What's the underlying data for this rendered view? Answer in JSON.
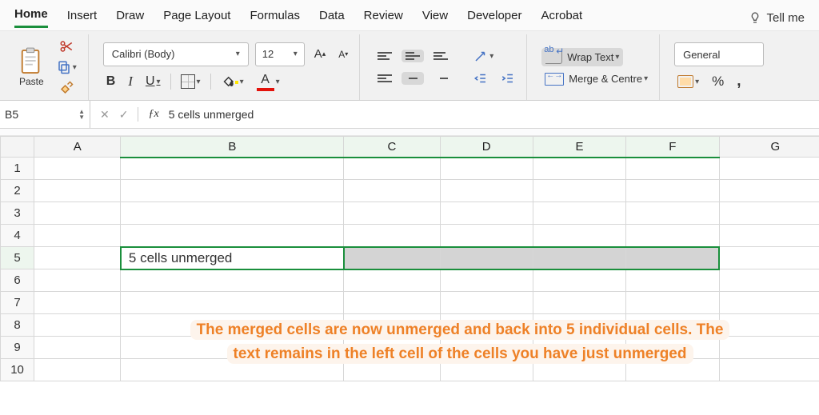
{
  "tabs": [
    "Home",
    "Insert",
    "Draw",
    "Page Layout",
    "Formulas",
    "Data",
    "Review",
    "View",
    "Developer",
    "Acrobat"
  ],
  "active_tab_index": 0,
  "tellme_label": "Tell me",
  "clipboard": {
    "paste_label": "Paste"
  },
  "font": {
    "name": "Calibri (Body)",
    "size": "12",
    "bold": "B",
    "italic": "I",
    "underline": "U",
    "fill_letter": "",
    "font_letter": "A"
  },
  "alignment": {
    "wrap_label": "Wrap Text",
    "merge_label": "Merge & Centre"
  },
  "number": {
    "format": "General",
    "percent": "%",
    "comma": ","
  },
  "namebox": {
    "ref": "B5"
  },
  "formula_bar": {
    "value": "5 cells unmerged"
  },
  "columns": [
    "A",
    "B",
    "C",
    "D",
    "E",
    "F",
    "G"
  ],
  "rows": [
    "1",
    "2",
    "3",
    "4",
    "5",
    "6",
    "7",
    "8",
    "9",
    "10"
  ],
  "selection": {
    "active": "B5",
    "range_cols": [
      "B",
      "C",
      "D",
      "E",
      "F"
    ]
  },
  "cells": {
    "B5": "5 cells unmerged"
  },
  "annotation": "The merged cells are now unmerged and back into 5 individual cells. The text remains in the left cell of the cells you have just unmerged"
}
